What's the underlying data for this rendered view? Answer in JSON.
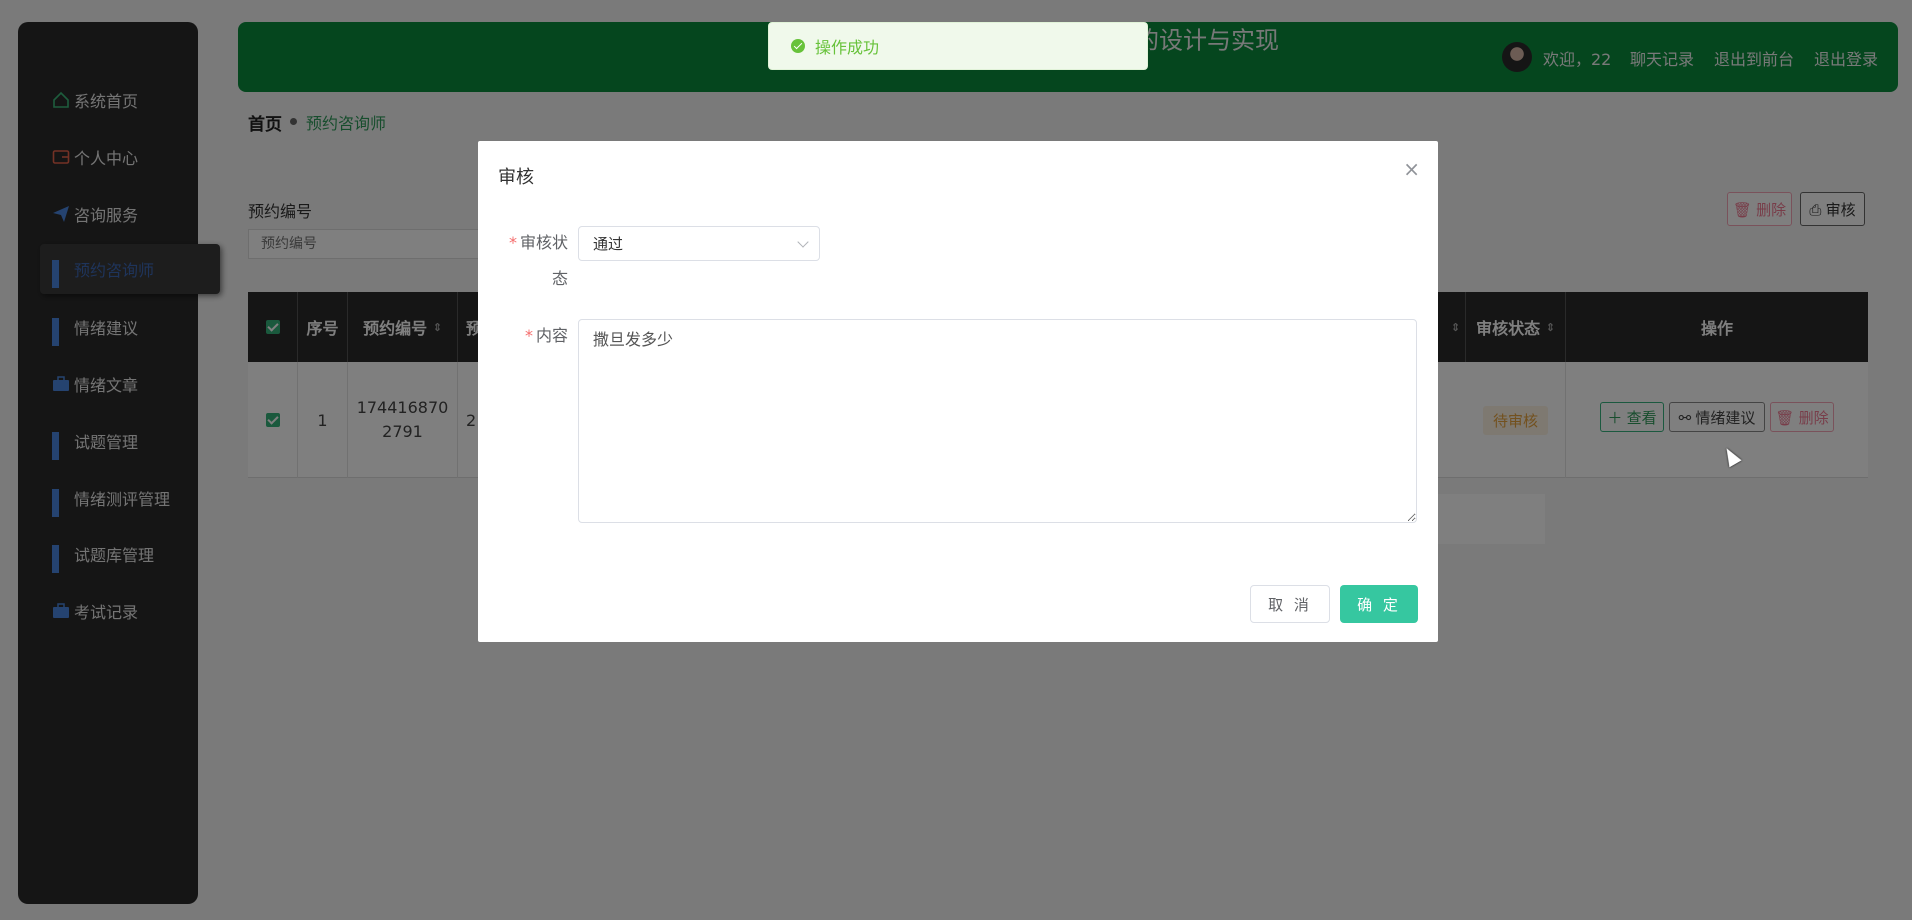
{
  "sidebar": {
    "items": [
      {
        "label": "系统首页",
        "icon": "home-icon"
      },
      {
        "label": "个人中心",
        "icon": "wallet-icon"
      },
      {
        "label": "咨询服务",
        "icon": "send-icon"
      },
      {
        "label": "预约咨询师",
        "icon": "grid-icon"
      },
      {
        "label": "情绪建议",
        "icon": "grid-icon"
      },
      {
        "label": "情绪文章",
        "icon": "briefcase-icon"
      },
      {
        "label": "试题管理",
        "icon": "grid-icon"
      },
      {
        "label": "情绪测评管理",
        "icon": "grid-icon"
      },
      {
        "label": "试题库管理",
        "icon": "grid-icon"
      },
      {
        "label": "考试记录",
        "icon": "briefcase-icon"
      }
    ],
    "active_index": 3
  },
  "header": {
    "title": "的设计与实现",
    "welcome": "欢迎，22",
    "links": [
      "聊天记录",
      "退出到前台",
      "退出登录"
    ]
  },
  "breadcrumb": {
    "home": "首页",
    "current": "预约咨询师"
  },
  "search": {
    "label": "预约编号",
    "placeholder": "预约编号"
  },
  "toolbar": {
    "delete_label": "删除",
    "audit_label": "审核"
  },
  "table": {
    "headers": [
      "序号",
      "预约编号",
      "预",
      "审核状态",
      "操作"
    ],
    "rows": [
      {
        "index": "1",
        "booking_no": "1744168702791",
        "partial": "2",
        "status": "待审核"
      }
    ],
    "row_actions": [
      "查看",
      "情绪建议",
      "删除"
    ]
  },
  "dialog": {
    "title": "审核",
    "status_label": "审核状态",
    "status_value": "通过",
    "content_label": "内容",
    "content_value": "撒旦发多少",
    "cancel_label": "取 消",
    "ok_label": "确 定"
  },
  "toast": {
    "message": "操作成功"
  },
  "colors": {
    "header": "#0a8c3c",
    "accent": "#36c7a0",
    "success": "#67c23a",
    "danger": "#f56c6c"
  }
}
